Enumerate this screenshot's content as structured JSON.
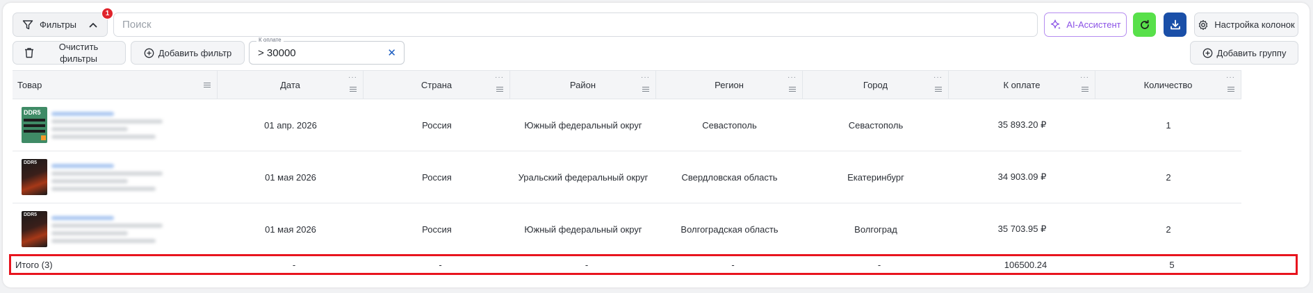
{
  "toolbar": {
    "filters_label": "Фильтры",
    "filters_badge": "1",
    "search_placeholder": "Поиск",
    "ai_label": "AI-Ассистент",
    "columns_label": "Настройка колонок",
    "clear_filters_label": "Очистить фильтры",
    "add_filter_label": "Добавить фильтр",
    "add_group_label": "Добавить группу"
  },
  "active_filter": {
    "field_label": "К оплате",
    "value": "> 30000"
  },
  "colors": {
    "accent": "#1a5cc0",
    "ai": "#8b52e6",
    "refresh": "#58e04a",
    "download": "#1a4fa8",
    "highlight": "#e8141e"
  },
  "table": {
    "headers": [
      "Товар",
      "Дата",
      "Страна",
      "Район",
      "Регион",
      "Город",
      "К оплате",
      "Количество"
    ],
    "rows": [
      {
        "thumb": "DDR5",
        "date": "01 апр. 2026",
        "country": "Россия",
        "district": "Южный федеральный округ",
        "region": "Севастополь",
        "city": "Севастополь",
        "payment": "35 893.20 ₽",
        "qty": "1"
      },
      {
        "thumb": "DDR5",
        "date": "01 мая 2026",
        "country": "Россия",
        "district": "Уральский федеральный округ",
        "region": "Свердловская область",
        "city": "Екатеринбург",
        "payment": "34 903.09 ₽",
        "qty": "2"
      },
      {
        "thumb": "DDR5",
        "date": "01 мая 2026",
        "country": "Россия",
        "district": "Южный федеральный округ",
        "region": "Волгоградская область",
        "city": "Волгоград",
        "payment": "35 703.95 ₽",
        "qty": "2"
      }
    ],
    "totals": {
      "label": "Итого (3)",
      "date": "-",
      "country": "-",
      "district": "-",
      "region": "-",
      "city": "-",
      "payment": "106500.24",
      "qty": "5"
    }
  }
}
